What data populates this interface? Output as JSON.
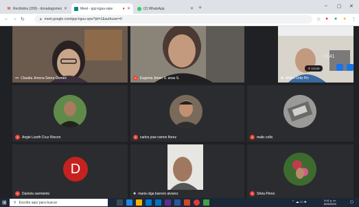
{
  "browser": {
    "tabs": [
      {
        "title": "Recibidos (209) - donadagomez",
        "favicon": "gmail-icon",
        "favicon_color": "#d93025"
      },
      {
        "title": "Meet - gqz-kguu-opw",
        "favicon": "meet-icon",
        "favicon_color": "#00897b",
        "active": true
      },
      {
        "title": "(2) WhatsApp",
        "favicon": "whatsapp-icon",
        "favicon_color": "#25d366"
      }
    ],
    "url": "meet.google.com/gqz-kguu-opw?pli=1&authuser=0"
  },
  "meet": {
    "clock": "15:41",
    "rec_label": "113:26",
    "participants": [
      {
        "name": "Claudia Jimena Sierra Gomez",
        "muted": false
      },
      {
        "name": "Eugenia Jimen S. anas S.",
        "muted": true
      },
      {
        "name": "Milton Ortiz Pic",
        "muted": false
      },
      {
        "name": "Angie Lizeth Cruz Rincon",
        "muted": true
      },
      {
        "name": "carlos jose ramon florez",
        "muted": true
      },
      {
        "name": "malic cello",
        "muted": true
      },
      {
        "name": "Daniela sarmiento",
        "muted": true,
        "initial": "D",
        "avatar_color": "#c5221f"
      },
      {
        "name": "maria olga barrero alvarez",
        "muted": false
      },
      {
        "name": "Silvia Pérez",
        "muted": true
      }
    ]
  },
  "taskbar": {
    "search_placeholder": "Escribe aquí para buscar",
    "time": "3:41 p. m.",
    "date": "8/05/2020"
  }
}
